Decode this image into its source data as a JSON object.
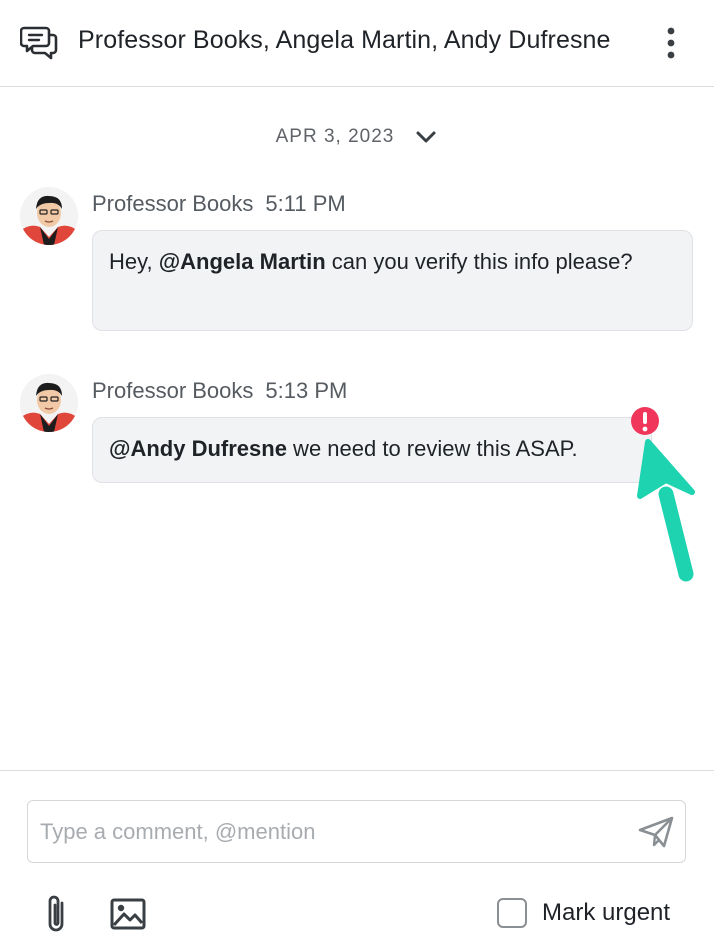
{
  "header": {
    "title": "Professor Books, Angela Martin, Andy Dufresne",
    "icon": "chat-bubbles-icon",
    "menu_icon": "more-vertical-icon"
  },
  "date_divider": {
    "label": "APR 3, 2023",
    "icon": "chevron-down-icon"
  },
  "messages": [
    {
      "author": "Professor Books",
      "time": "5:11 PM",
      "mention": "@Angela Martin",
      "text_before": "Hey, ",
      "text_after": " can you verify this info please?",
      "urgent": false
    },
    {
      "author": "Professor Books",
      "time": "5:13 PM",
      "mention": "@Andy Dufresne",
      "text_before": "",
      "text_after": " we need to review this ASAP.",
      "urgent": true
    }
  ],
  "composer": {
    "placeholder": "Type a comment, @mention",
    "value": "",
    "send_icon": "send-icon",
    "attach_icon": "paperclip-icon",
    "image_icon": "image-icon"
  },
  "urgent_toggle": {
    "label": "Mark urgent",
    "checked": false
  },
  "colors": {
    "urgent": "#f0365a",
    "annotation_arrow": "#1ed3b0",
    "bubble_bg": "#f2f3f5"
  }
}
